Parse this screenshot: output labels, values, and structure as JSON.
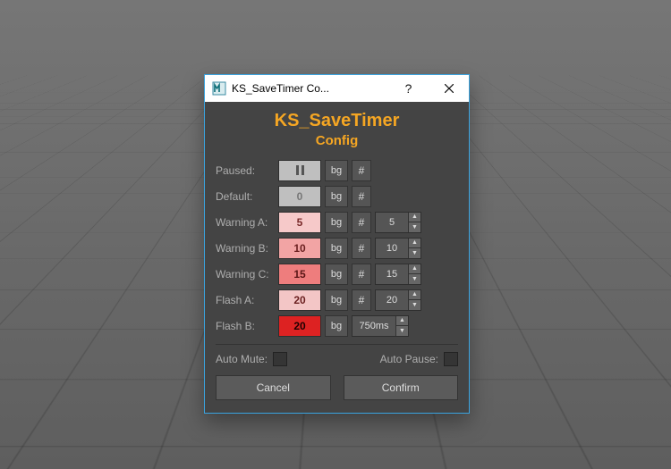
{
  "window": {
    "title": "KS_SaveTimer Co..."
  },
  "header": {
    "line1": "KS_SaveTimer",
    "line2": "Config"
  },
  "rows": {
    "paused": {
      "label": "Paused:",
      "swatch_text": "",
      "swatch_color": "#bfbfbf",
      "text_color": "#555",
      "bg_label": "bg",
      "hash_label": "#",
      "has_spin": false
    },
    "default": {
      "label": "Default:",
      "swatch_text": "0",
      "swatch_color": "#bfbfbf",
      "text_color": "#777",
      "bg_label": "bg",
      "hash_label": "#",
      "has_spin": false
    },
    "warningA": {
      "label": "Warning A:",
      "swatch_text": "5",
      "swatch_color": "#f6c9c9",
      "text_color": "#7a2b2b",
      "bg_label": "bg",
      "hash_label": "#",
      "has_spin": true,
      "spin_value": "5"
    },
    "warningB": {
      "label": "Warning B:",
      "swatch_text": "10",
      "swatch_color": "#f2a4a4",
      "text_color": "#6a1f1f",
      "bg_label": "bg",
      "hash_label": "#",
      "has_spin": true,
      "spin_value": "10"
    },
    "warningC": {
      "label": "Warning C:",
      "swatch_text": "15",
      "swatch_color": "#ee7d7d",
      "text_color": "#5a1616",
      "bg_label": "bg",
      "hash_label": "#",
      "has_spin": true,
      "spin_value": "15"
    },
    "flashA": {
      "label": "Flash A:",
      "swatch_text": "20",
      "swatch_color": "#f3c6c6",
      "text_color": "#6a1f1f",
      "bg_label": "bg",
      "hash_label": "#",
      "has_spin": true,
      "spin_value": "20"
    },
    "flashB": {
      "label": "Flash B:",
      "swatch_text": "20",
      "swatch_color": "#dd2222",
      "text_color": "#1d0000",
      "bg_label": "bg",
      "hash_label": "",
      "has_spin": true,
      "spin_value": "750ms"
    }
  },
  "checks": {
    "auto_mute": "Auto Mute:",
    "auto_pause": "Auto Pause:"
  },
  "buttons": {
    "cancel": "Cancel",
    "confirm": "Confirm"
  },
  "colors": {
    "accent": "#f5a623",
    "dialog_bg": "#444444",
    "window_border": "#3aa4e0"
  }
}
